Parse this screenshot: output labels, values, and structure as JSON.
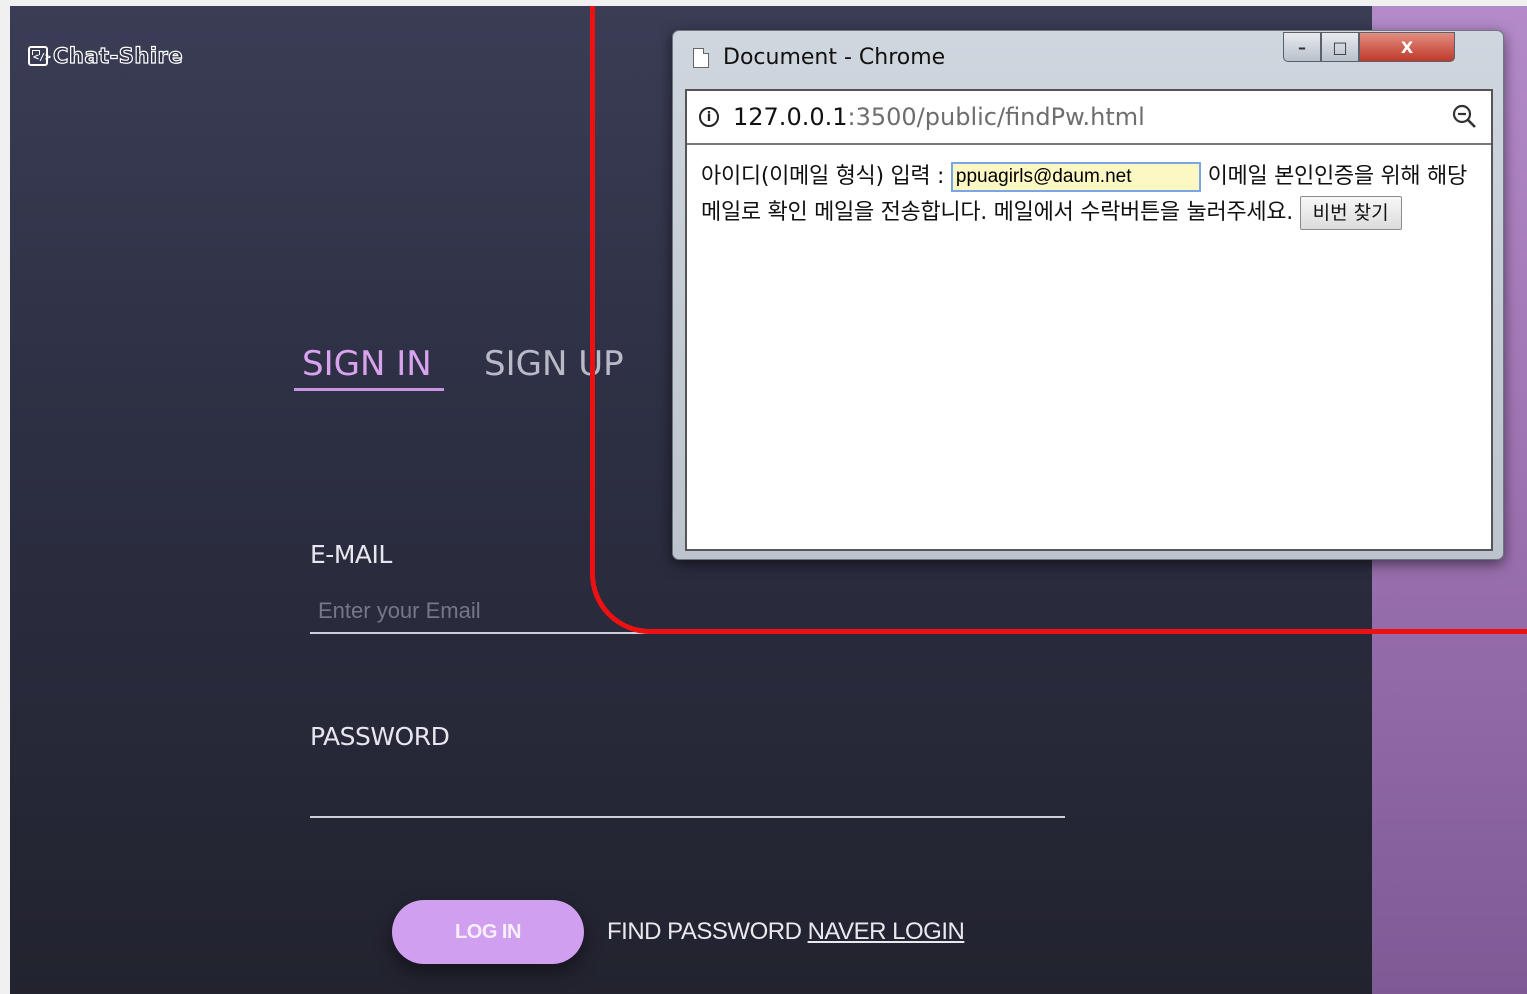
{
  "app": {
    "logo_text": "Chat-Shire",
    "tabs": {
      "sign_in": "SIGN IN",
      "sign_up": "SIGN UP"
    },
    "email": {
      "label": "E-MAIL",
      "placeholder": "Enter your Email",
      "value": ""
    },
    "password": {
      "label": "PASSWORD",
      "value": ""
    },
    "login_button": "LOG IN",
    "find_password": "FIND PASSWORD",
    "naver_login": "NAVER LOGIN",
    "accent_color": "#d09ff0"
  },
  "popup": {
    "title": "Document - Chrome",
    "controls": {
      "minimize": "–",
      "maximize": "□",
      "close": "X"
    },
    "url_host": "127.0.0.1",
    "url_rest": ":3500/public/findPw.html",
    "prompt_label": "아이디(이메일 형식) 입력 :",
    "id_value": "ppuagirls@daum.net",
    "description": "이메일 본인인증을 위해 해당 메일로 확인 메일을 전송합니다. 메일에서 수락버튼을 눌러주세요.",
    "find_button": "비번 찾기"
  },
  "highlight_color": "#ee1111"
}
